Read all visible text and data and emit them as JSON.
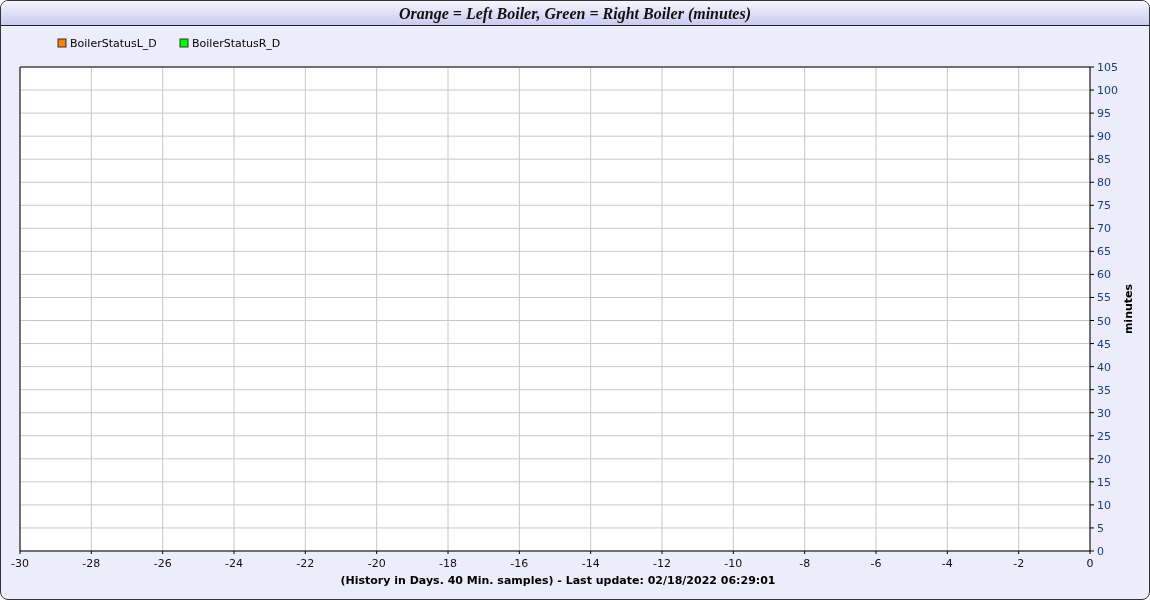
{
  "panel": {
    "title": "Orange = Left Boiler, Green = Right Boiler (minutes)",
    "chart_data": {
      "type": "line",
      "xlabel": "(History in Days. 40 Min. samples) - Last update: 02/18/2022 06:29:01",
      "ylabel": "minutes",
      "grid": true,
      "ylim": [
        0,
        105
      ],
      "categories": [
        "-30",
        "-28",
        "-26",
        "-24",
        "-22",
        "-20",
        "-18",
        "-16",
        "-14",
        "-12",
        "-10",
        "-8",
        "-6",
        "-4",
        "-2",
        "0"
      ],
      "yticks": [
        0,
        5,
        10,
        15,
        20,
        25,
        30,
        35,
        40,
        45,
        50,
        55,
        60,
        65,
        70,
        75,
        80,
        85,
        90,
        95,
        100,
        105
      ],
      "series": [
        {
          "name": "BoilerStatusL_D",
          "color": "#ff8000",
          "values": [
            null,
            null,
            null,
            null,
            null,
            null,
            null,
            null,
            null,
            null,
            null,
            null,
            null,
            null,
            null,
            null
          ]
        },
        {
          "name": "BoilerStatusR_D",
          "color": "#00ff00",
          "values": [
            null,
            null,
            null,
            null,
            null,
            null,
            null,
            null,
            null,
            null,
            null,
            null,
            null,
            null,
            null,
            null
          ]
        }
      ]
    }
  }
}
